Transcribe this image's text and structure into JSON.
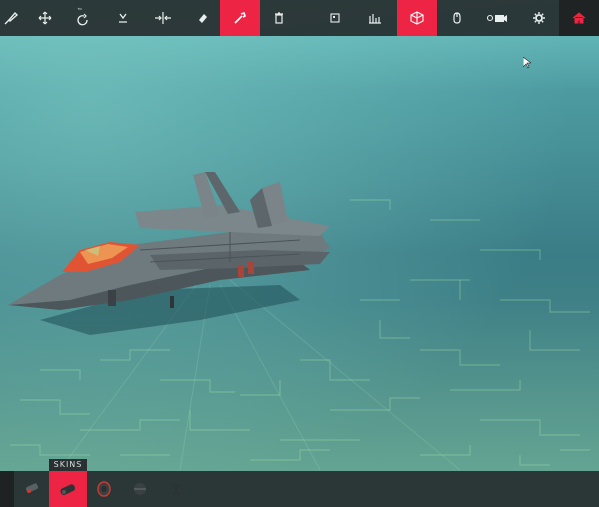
{
  "toolbar": {
    "buttons": [
      {
        "name": "brush-tool-icon",
        "active": false
      },
      {
        "name": "move-icon",
        "active": false
      },
      {
        "name": "rotate-icon",
        "active": false
      },
      {
        "name": "snap-down-icon",
        "active": false
      },
      {
        "name": "mirror-icon",
        "active": false
      },
      {
        "name": "eraser-icon",
        "active": false
      },
      {
        "name": "wrench-icon",
        "active": true
      },
      {
        "name": "trash-icon",
        "active": false
      },
      {
        "name": "copy-icon",
        "active": false
      },
      {
        "name": "stats-icon",
        "active": false
      },
      {
        "name": "block-cube-icon",
        "active": true
      },
      {
        "name": "mouse-icon",
        "active": false
      },
      {
        "name": "camera-icon",
        "active": false
      },
      {
        "name": "gear-icon",
        "active": false
      },
      {
        "name": "home-icon",
        "active": false
      }
    ]
  },
  "bottom_bar": {
    "skins_label": "SKINS",
    "items": [
      {
        "name": "cannon-block-icon",
        "active": false
      },
      {
        "name": "skin-block-icon",
        "active": true
      },
      {
        "name": "wheel-block-icon",
        "active": false
      },
      {
        "name": "bomb-block-icon",
        "active": false
      },
      {
        "name": "grabber-block-icon",
        "active": false
      }
    ]
  },
  "colors": {
    "accent": "#ee2444",
    "toolbar_bg": "#262c2e",
    "sky": "#3f7f86"
  }
}
